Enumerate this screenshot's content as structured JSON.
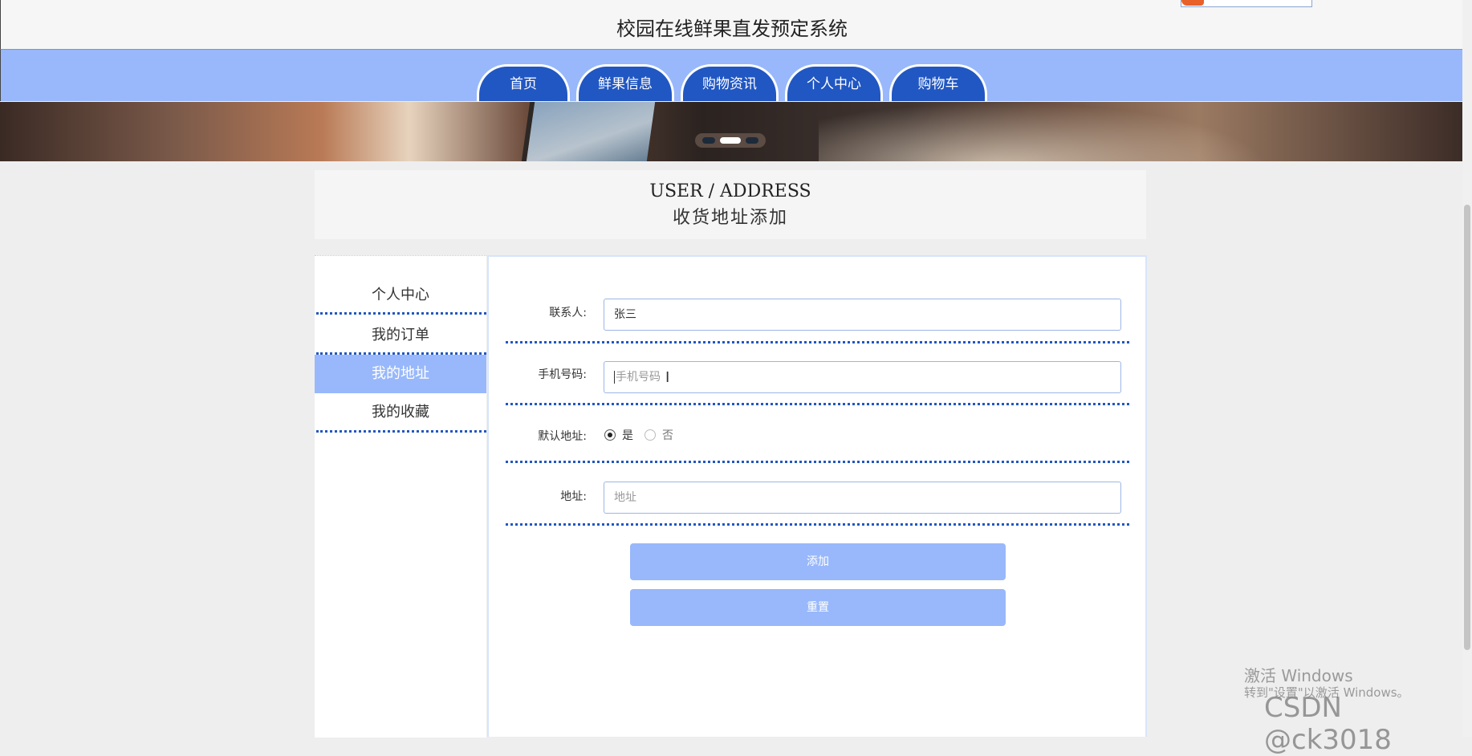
{
  "header": {
    "title": "校园在线鲜果直发预定系统"
  },
  "nav": {
    "items": [
      {
        "label": "首页"
      },
      {
        "label": "鲜果信息"
      },
      {
        "label": "购物资讯"
      },
      {
        "label": "个人中心"
      },
      {
        "label": "购物车"
      }
    ]
  },
  "banner": {
    "slide_count": 3,
    "active_slide": 2
  },
  "page_heading": {
    "en": "USER / ADDRESS",
    "cn": "收货地址添加"
  },
  "sidebar": {
    "items": [
      {
        "label": "个人中心"
      },
      {
        "label": "我的订单"
      },
      {
        "label": "我的地址",
        "active": true
      },
      {
        "label": "我的收藏"
      }
    ]
  },
  "form": {
    "contact": {
      "label": "联系人:",
      "value": "张三"
    },
    "phone": {
      "label": "手机号码:",
      "placeholder": "手机号码"
    },
    "default_address": {
      "label": "默认地址:",
      "options": [
        {
          "label": "是",
          "checked": true
        },
        {
          "label": "否",
          "checked": false
        }
      ]
    },
    "address": {
      "label": "地址:",
      "placeholder": "地址"
    },
    "submit_label": "添加",
    "reset_label": "重置"
  },
  "watermarks": {
    "windows_line1": "激活 Windows",
    "windows_line2": "转到\"设置\"以激活 Windows。",
    "csdn": "CSDN @ck3018"
  },
  "colors": {
    "accent": "#2157c2",
    "nav_bg": "#98b8fb",
    "button": "#98b8fb"
  }
}
